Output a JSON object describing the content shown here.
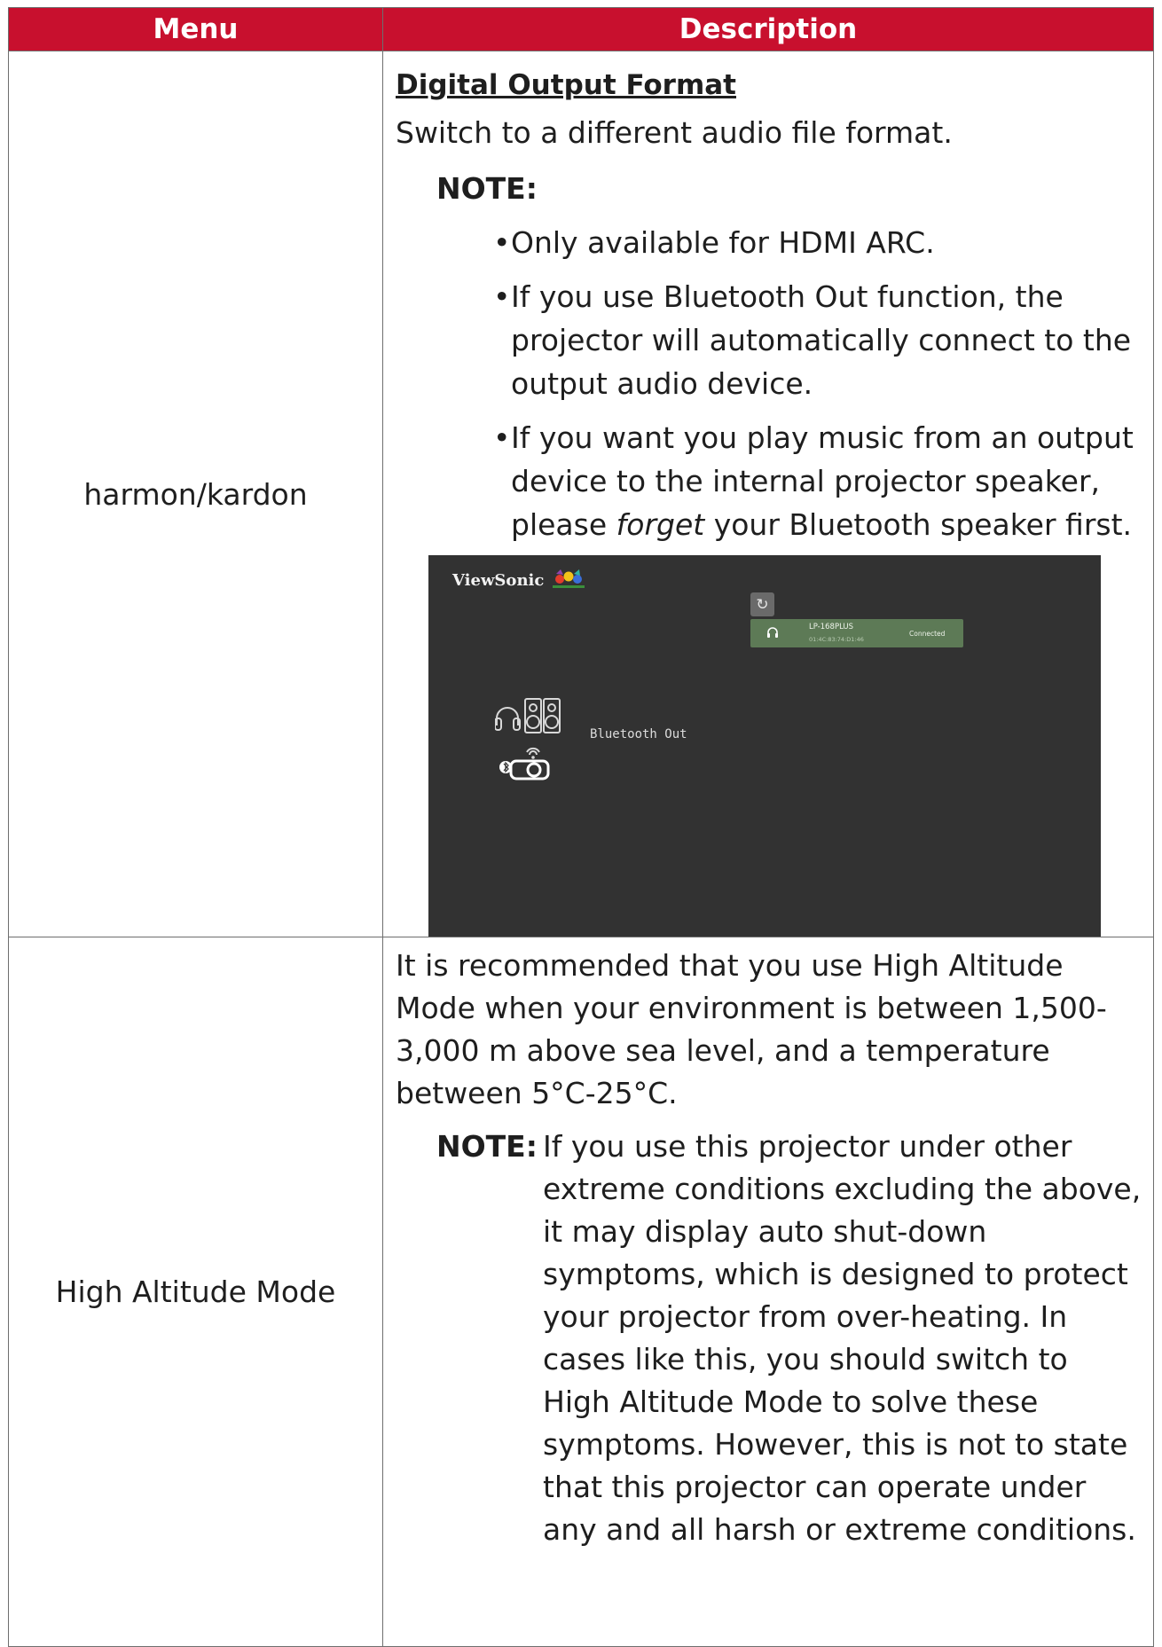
{
  "header": {
    "menu": "Menu",
    "description": "Description"
  },
  "row1": {
    "menu": "harmon/kardon",
    "section_title": "Digital Output Format",
    "section_text": "Switch to a different audio file format.",
    "note_label": "NOTE:",
    "notes": [
      "Only available for HDMI ARC.",
      "If you use Bluetooth Out function, the projector will automatically connect to the output audio device."
    ],
    "note3_prefix": "If you want you play music from an output device to the internal projector speaker, please ",
    "note3_italic": "forget",
    "note3_suffix": " your Bluetooth speaker first.",
    "screenshot": {
      "brand": "ViewSonic",
      "device_name": "LP-168PLUS",
      "device_address": "01:4C:83:74:D1:46",
      "device_status": "Connected",
      "panel_label": "Bluetooth Out",
      "refresh_icon": "↻",
      "colors": {
        "background": "#323232",
        "device_row": "#5d7a56"
      }
    }
  },
  "row2": {
    "menu": "High Altitude Mode",
    "paragraph": "It is recommended that you use High Altitude Mode when your environment is between 1,500-3,000 m above sea level, and a temperature between 5°C-25°C.",
    "note_label": "NOTE:",
    "note_text": "If you use this projector under other extreme conditions excluding the above, it may display auto shut-down symptoms, which is designed to protect your projector from over-heating. In cases like this, you should switch to High Altitude Mode to solve these symptoms. However, this is not to state that this projector can operate under any and all harsh or extreme conditions."
  },
  "colors": {
    "header_bg": "#c8102e",
    "header_text": "#ffffff",
    "border": "#6e6e6e"
  }
}
